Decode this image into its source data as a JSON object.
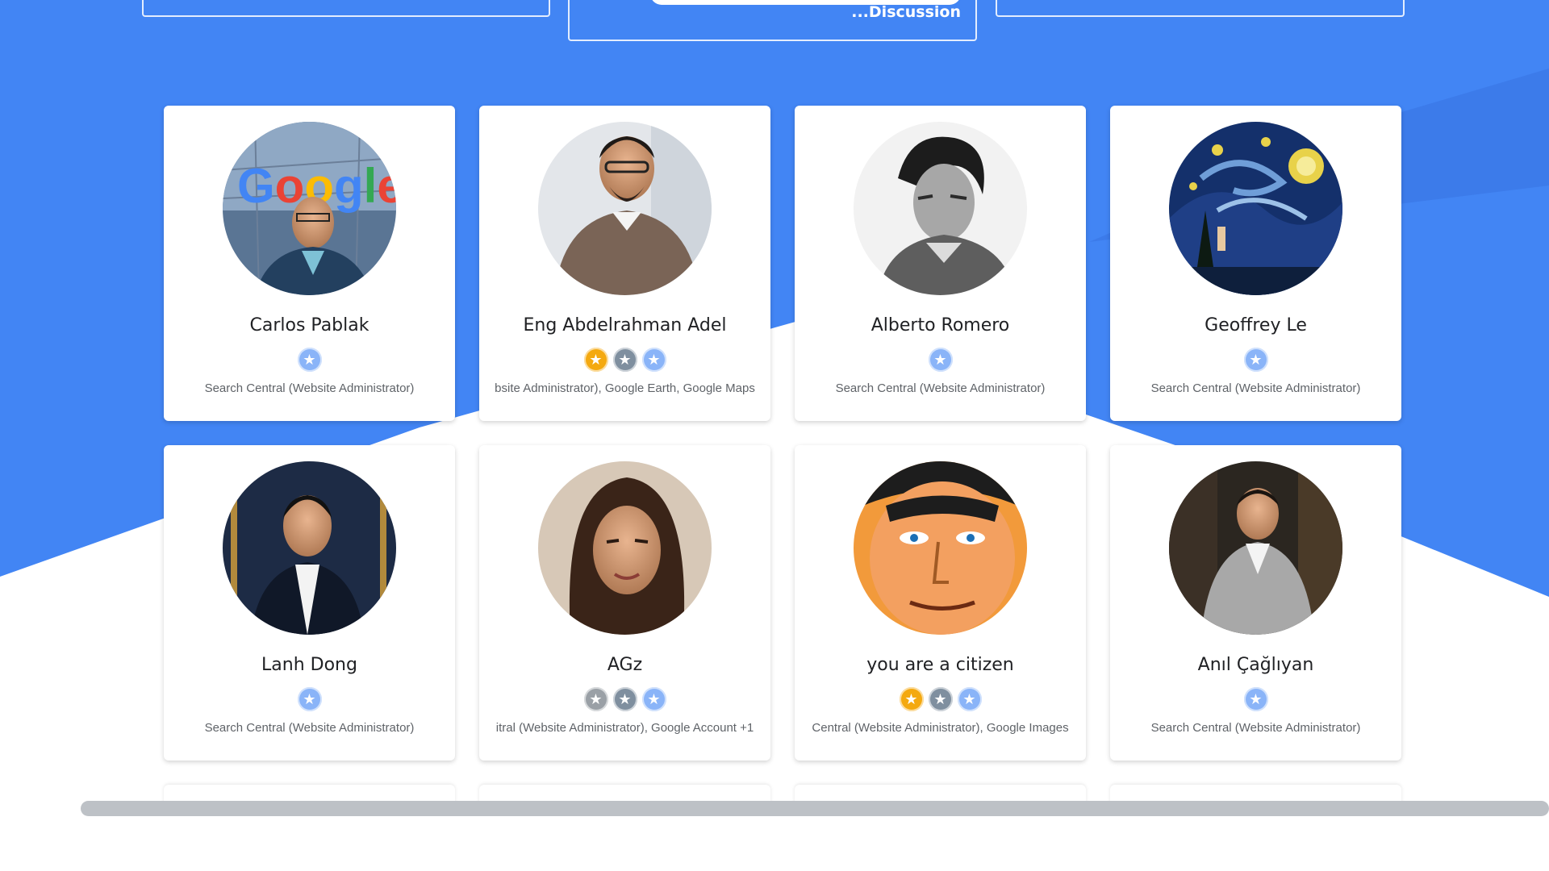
{
  "top": {
    "discussion_link": "...Discussion"
  },
  "members": [
    {
      "name": "Carlos Pablak",
      "badges": [
        "blue"
      ],
      "products": "Search Central (Website Administrator)",
      "avatar": "google-sign-man"
    },
    {
      "name": "Eng Abdelrahman Adel",
      "badges": [
        "gold",
        "steel",
        "blue"
      ],
      "products": "bsite Administrator), Google Earth, Google Maps",
      "avatar": "man-glasses-sweater"
    },
    {
      "name": "Alberto Romero",
      "badges": [
        "blue"
      ],
      "products": "Search Central (Website Administrator)",
      "avatar": "bw-portrait"
    },
    {
      "name": "Geoffrey Le",
      "badges": [
        "blue"
      ],
      "products": "Search Central (Website Administrator)",
      "avatar": "starry-night"
    },
    {
      "name": "Lanh Dong",
      "badges": [
        "blue"
      ],
      "products": "Search Central (Website Administrator)",
      "avatar": "man-suit"
    },
    {
      "name": "AGz",
      "badges": [
        "silver",
        "steel",
        "blue"
      ],
      "products": "itral (Website Administrator), Google Account +1",
      "avatar": "woman-portrait"
    },
    {
      "name": "you are a citizen",
      "badges": [
        "gold",
        "steel",
        "blue"
      ],
      "products": "Central (Website Administrator), Google Images",
      "avatar": "comic-hero"
    },
    {
      "name": "Anıl Çağlıyan",
      "badges": [
        "blue"
      ],
      "products": "Search Central (Website Administrator)",
      "avatar": "man-grey-suit"
    }
  ],
  "colors": {
    "brand_blue": "#4285f4",
    "gold_badge": "#f4a910",
    "blue_badge": "#8ab4f8"
  }
}
